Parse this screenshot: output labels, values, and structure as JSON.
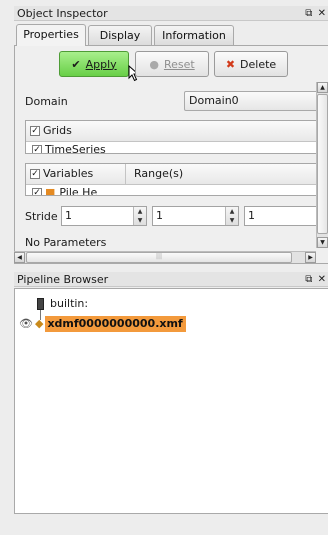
{
  "object_inspector": {
    "title": "Object Inspector",
    "dock_buttons": "̅×",
    "tabs": [
      {
        "label": "Properties"
      },
      {
        "label": "Display"
      },
      {
        "label": "Information"
      }
    ],
    "buttons": {
      "apply": "Apply",
      "reset": "Reset",
      "delete": "Delete"
    },
    "domain_label": "Domain",
    "domain_value": "Domain0",
    "grids": {
      "header": "Grids",
      "items": [
        "TimeSeries"
      ]
    },
    "variables": {
      "header": "Variables",
      "ranges_header": "Range(s)",
      "items": [
        "Pile He"
      ]
    },
    "stride_label": "Stride",
    "stride_values": [
      "1",
      "1",
      "1"
    ],
    "no_parameters": "No Parameters"
  },
  "pipeline_browser": {
    "title": "Pipeline Browser",
    "items": [
      {
        "label": "builtin:"
      },
      {
        "label": "xdmf0000000000.xmf"
      }
    ]
  },
  "colors": {
    "apply_green": "#68cf47",
    "selection_orange": "#f39a3c"
  }
}
